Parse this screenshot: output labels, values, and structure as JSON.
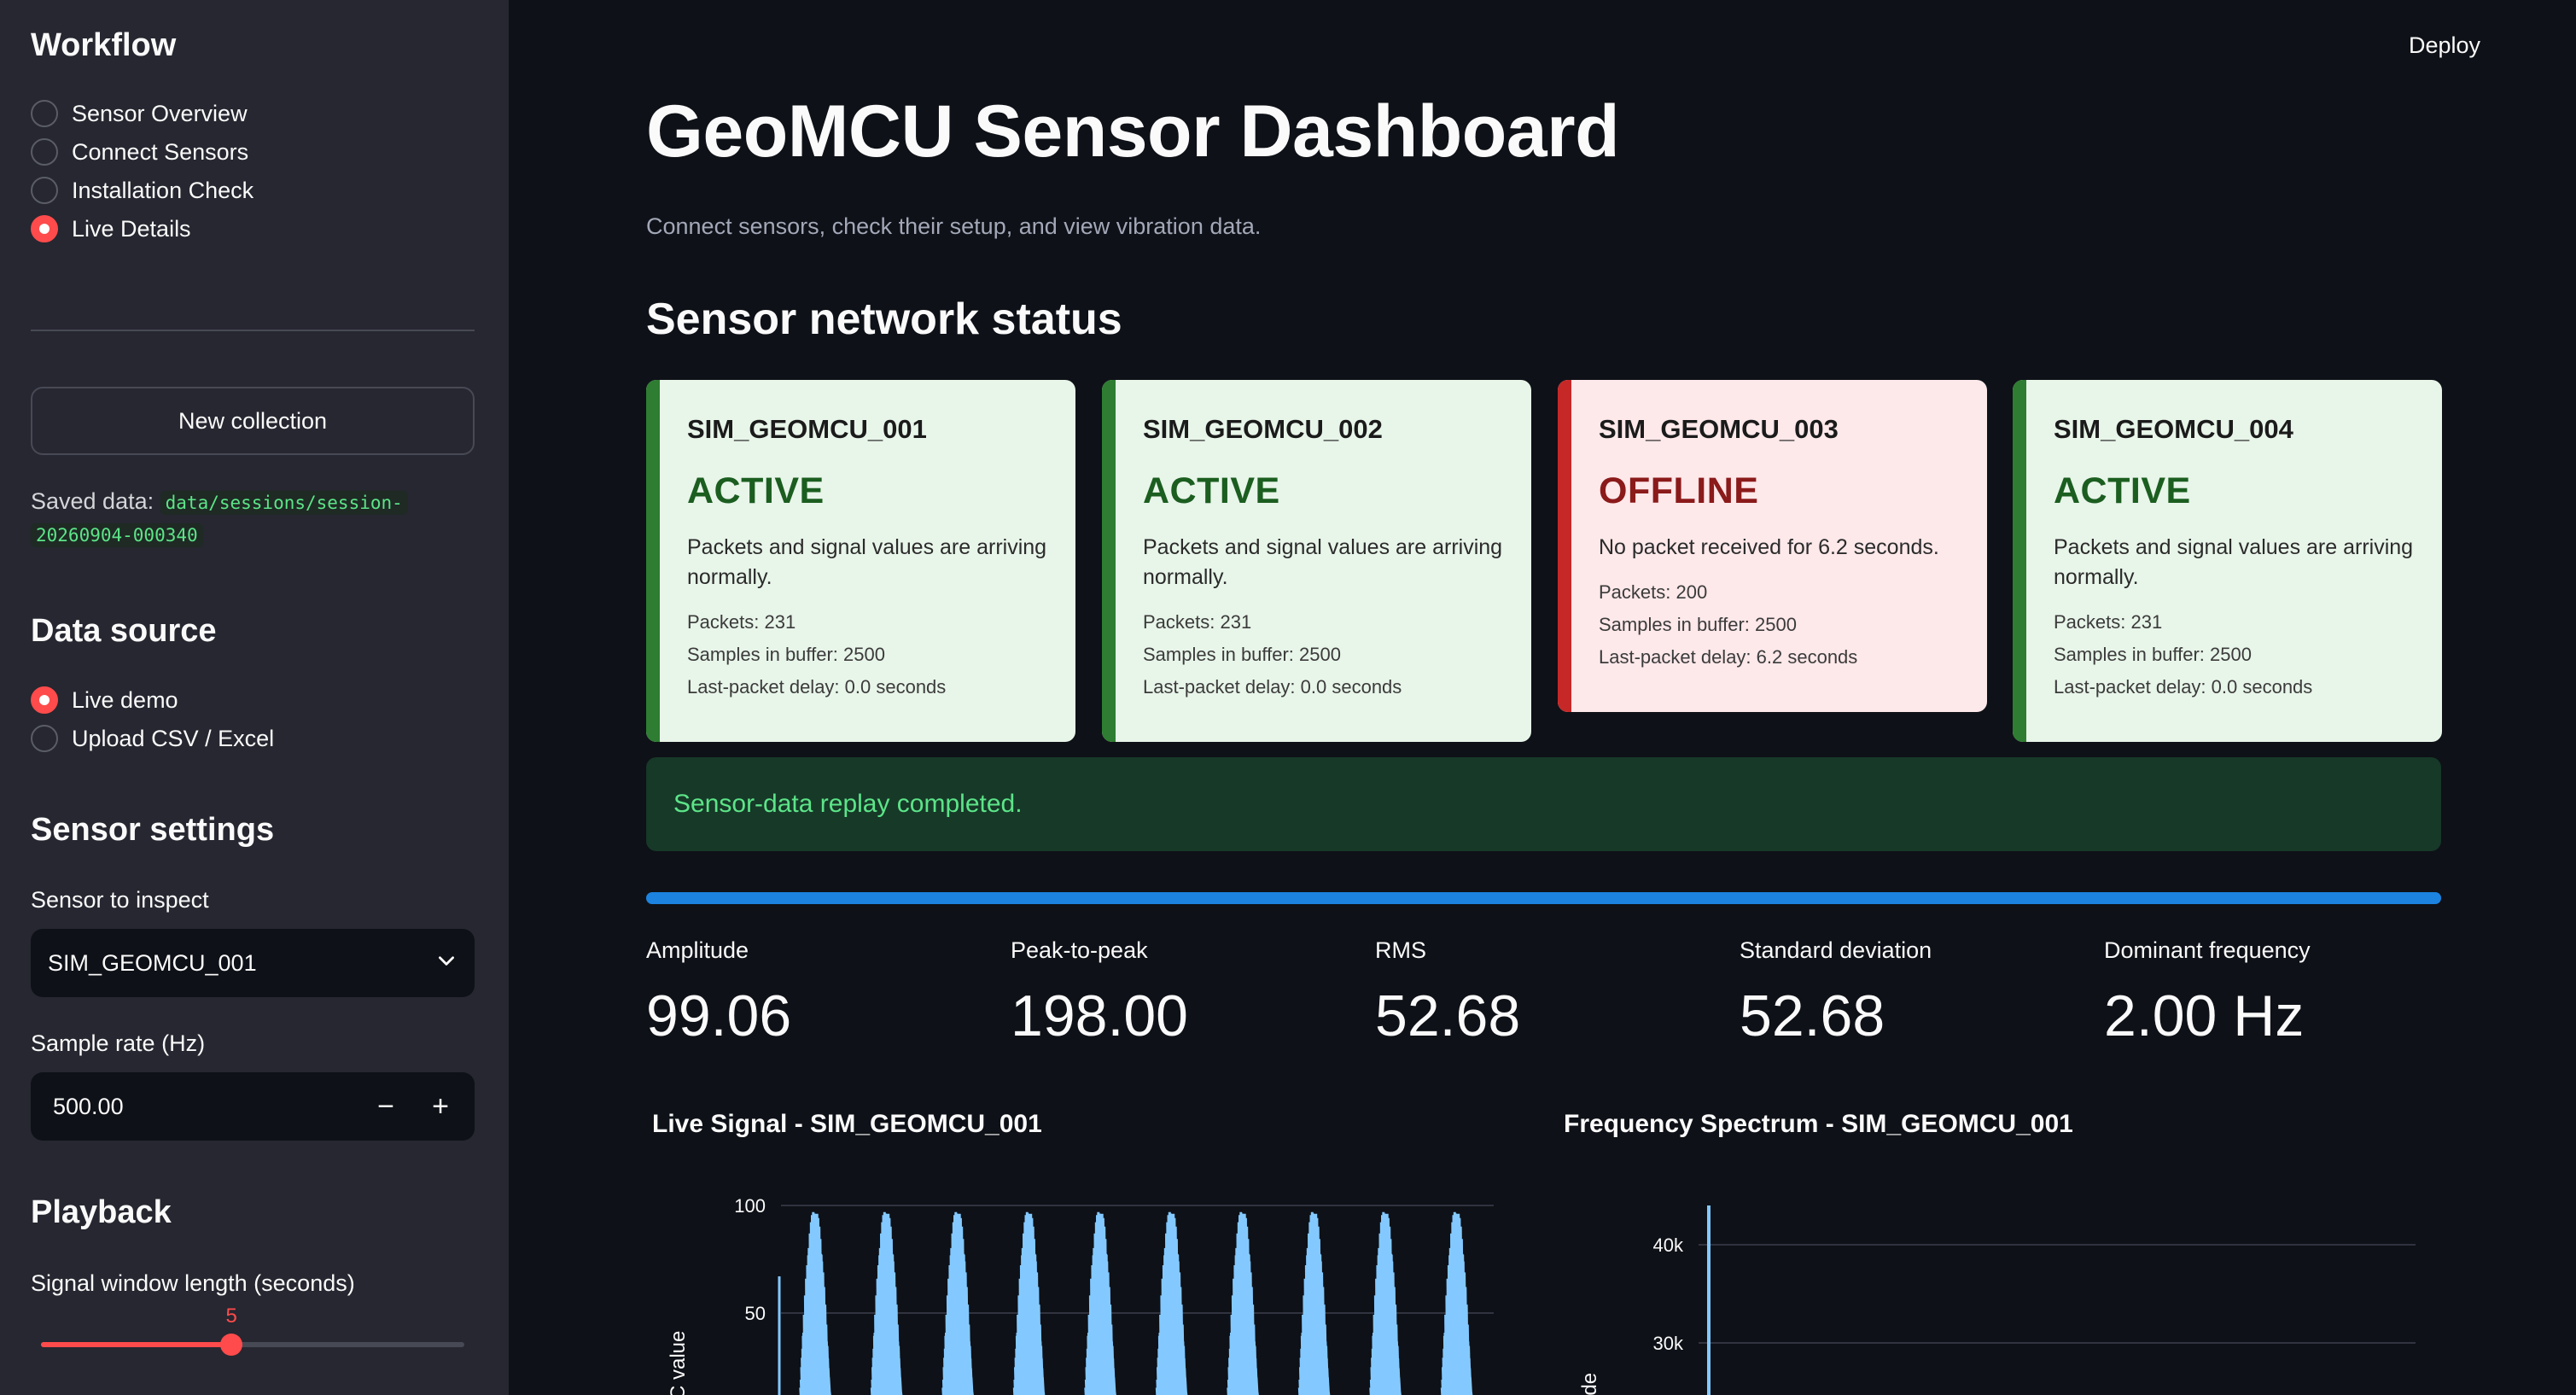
{
  "sidebar": {
    "workflow_title": "Workflow",
    "workflow_items": [
      {
        "label": "Sensor Overview",
        "selected": false
      },
      {
        "label": "Connect Sensors",
        "selected": false
      },
      {
        "label": "Installation Check",
        "selected": false
      },
      {
        "label": "Live Details",
        "selected": true
      }
    ],
    "new_collection_label": "New collection",
    "saved_data_label": "Saved data:",
    "saved_data_path_1": "data/sessions/session-",
    "saved_data_path_2": "20260904-000340",
    "data_source_title": "Data source",
    "data_source_items": [
      {
        "label": "Live demo",
        "selected": true
      },
      {
        "label": "Upload CSV / Excel",
        "selected": false
      }
    ],
    "sensor_settings_title": "Sensor settings",
    "sensor_to_inspect_label": "Sensor to inspect",
    "sensor_to_inspect_value": "SIM_GEOMCU_001",
    "sample_rate_label": "Sample rate (Hz)",
    "sample_rate_value": "500.00",
    "playback_title": "Playback",
    "window_length_label": "Signal window length (seconds)",
    "window_length_value": "5",
    "window_length_fraction": 0.45
  },
  "header": {
    "deploy_label": "Deploy"
  },
  "main": {
    "title": "GeoMCU Sensor Dashboard",
    "subtitle": "Connect sensors, check their setup, and view vibration data.",
    "section_title": "Sensor network status",
    "cards": [
      {
        "id": "SIM_GEOMCU_001",
        "status": "ACTIVE",
        "desc": "Packets and signal values are arriving normally.",
        "packets": "Packets: 231",
        "samples": "Samples in buffer: 2500",
        "delay": "Last-packet delay: 0.0 seconds"
      },
      {
        "id": "SIM_GEOMCU_002",
        "status": "ACTIVE",
        "desc": "Packets and signal values are arriving normally.",
        "packets": "Packets: 231",
        "samples": "Samples in buffer: 2500",
        "delay": "Last-packet delay: 0.0 seconds"
      },
      {
        "id": "SIM_GEOMCU_003",
        "status": "OFFLINE",
        "desc": "No packet received for 6.2 seconds.",
        "packets": "Packets: 200",
        "samples": "Samples in buffer: 2500",
        "delay": "Last-packet delay: 6.2 seconds"
      },
      {
        "id": "SIM_GEOMCU_004",
        "status": "ACTIVE",
        "desc": "Packets and signal values are arriving normally.",
        "packets": "Packets: 231",
        "samples": "Samples in buffer: 2500",
        "delay": "Last-packet delay: 0.0 seconds"
      }
    ],
    "alert_text": "Sensor-data replay completed.",
    "progress_fraction": 1.0,
    "metrics": [
      {
        "label": "Amplitude",
        "value": "99.06"
      },
      {
        "label": "Peak-to-peak",
        "value": "198.00"
      },
      {
        "label": "RMS",
        "value": "52.68"
      },
      {
        "label": "Standard deviation",
        "value": "52.68"
      },
      {
        "label": "Dominant frequency",
        "value": "2.00 Hz"
      }
    ]
  },
  "chart_data": [
    {
      "type": "line",
      "title": "Live Signal - SIM_GEOMCU_001",
      "ylabel": "C value",
      "yticks": [
        50,
        100
      ],
      "ylim": [
        0,
        100
      ],
      "cycles_visible": 10,
      "amplitude": 99
    },
    {
      "type": "line",
      "title": "Frequency Spectrum - SIM_GEOMCU_001",
      "ylabel": "itude",
      "yticks": [
        "30k",
        "40k"
      ],
      "ytick_values": [
        30000,
        40000
      ],
      "ylim": [
        20000,
        44000
      ],
      "peak": 44000
    }
  ],
  "colors": {
    "accent": "#ff4b4b",
    "active": "#2e7d32",
    "offline": "#c62828",
    "progress": "#1c83e1",
    "signal": "#83c9ff"
  }
}
